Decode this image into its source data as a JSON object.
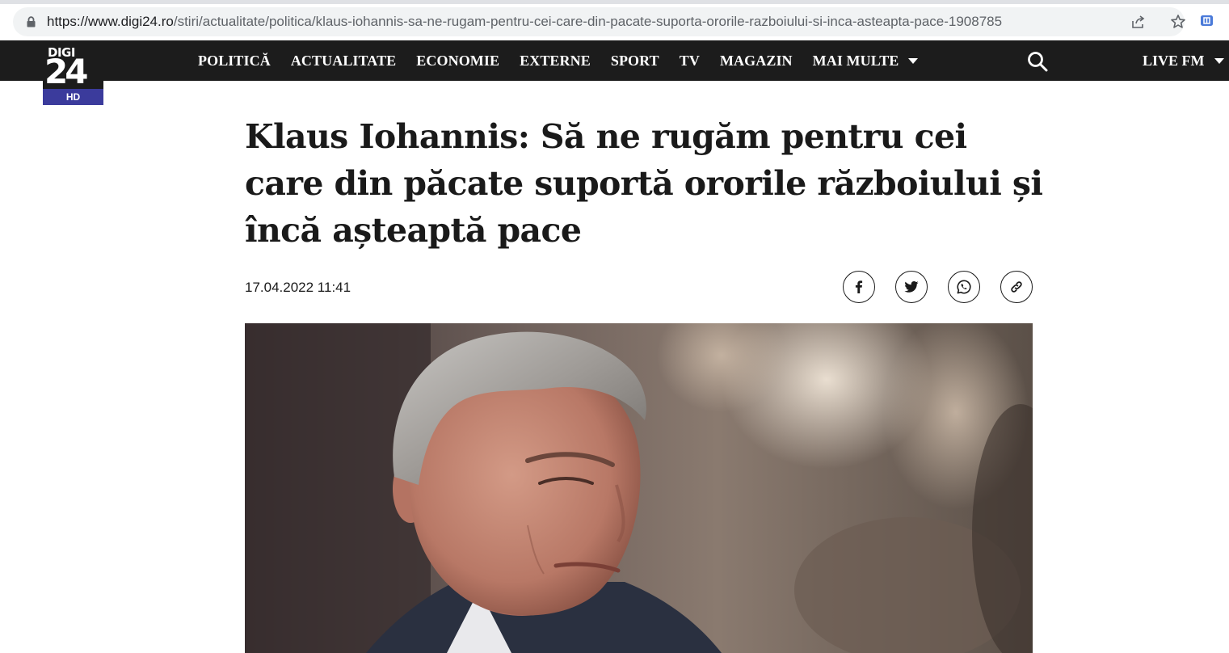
{
  "browser": {
    "url_host": "https://www.digi24.ro",
    "url_path": "/stiri/actualitate/politica/klaus-iohannis-sa-ne-rugam-pentru-cei-care-din-pacate-suporta-ororile-razboiului-si-inca-asteapta-pace-1908785"
  },
  "logo": {
    "top_text": "DIGI",
    "number_text": "24",
    "badge_text": "HD"
  },
  "nav": {
    "items": [
      "POLITICĂ",
      "ACTUALITATE",
      "ECONOMIE",
      "EXTERNE",
      "SPORT",
      "TV",
      "MAGAZIN"
    ],
    "more_label": "MAI MULTE",
    "live_label": "LIVE FM"
  },
  "article": {
    "title": "Klaus Iohannis: Să ne rugăm pentru cei care din păcate suportă ororile războiului și încă așteaptă pace",
    "date": "17.04.2022 11:41"
  },
  "share": {
    "icons": [
      "facebook-icon",
      "twitter-icon",
      "whatsapp-icon",
      "link-icon"
    ]
  },
  "colors": {
    "nav_background": "#1c1c1c",
    "logo_badge": "#3b3b9c",
    "title_text": "#1a1a1a"
  }
}
